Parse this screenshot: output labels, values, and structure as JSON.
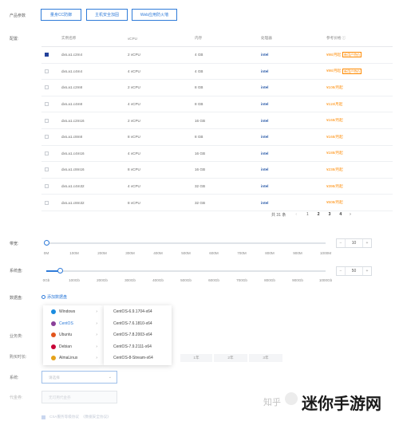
{
  "labels": {
    "product": "产品参数",
    "config": "配置:",
    "bandwidth": "带宽:",
    "system_disk": "系统盘:",
    "data_disk": "数据盘:",
    "business": "业务类:",
    "purchase_time": "购买时长:",
    "system": "系统:",
    "agent": "代金券:"
  },
  "top_buttons": [
    "量身CC防御",
    "主机安全加固",
    "Web应用防火墙"
  ],
  "table": {
    "headers": [
      "实例名称",
      "vCPU",
      "内存",
      "处理器",
      "参考价格"
    ],
    "info_icon": "ⓘ",
    "rows": [
      {
        "name": "dxs.a1.c2m4",
        "vcpu": "2 vCPU",
        "mem": "4 GB",
        "proc": "intel",
        "price": "¥98/月起",
        "tag": "新用户特价",
        "checked": true
      },
      {
        "name": "dxs.a1.c4m4",
        "vcpu": "4 vCPU",
        "mem": "4 GB",
        "proc": "intel",
        "price": "¥98/月起",
        "tag": "新用户特价",
        "checked": false
      },
      {
        "name": "dxs.a1.c2m8",
        "vcpu": "2 vCPU",
        "mem": "8 GB",
        "proc": "intel",
        "price": "¥108/月起",
        "tag": "",
        "checked": false
      },
      {
        "name": "dxs.a1.c4m8",
        "vcpu": "4 vCPU",
        "mem": "8 GB",
        "proc": "intel",
        "price": "¥118/月起",
        "tag": "",
        "checked": false
      },
      {
        "name": "dxs.a1.c2m16",
        "vcpu": "2 vCPU",
        "mem": "16 GB",
        "proc": "intel",
        "price": "¥168/月起",
        "tag": "",
        "checked": false
      },
      {
        "name": "dxs.a1.c8m8",
        "vcpu": "8 vCPU",
        "mem": "8 GB",
        "proc": "intel",
        "price": "¥168/月起",
        "tag": "",
        "checked": false
      },
      {
        "name": "dxs.a1.c4m16",
        "vcpu": "4 vCPU",
        "mem": "16 GB",
        "proc": "intel",
        "price": "¥188/月起",
        "tag": "",
        "checked": false
      },
      {
        "name": "dxs.a1.c8m16",
        "vcpu": "8 vCPU",
        "mem": "16 GB",
        "proc": "intel",
        "price": "¥238/月起",
        "tag": "",
        "checked": false
      },
      {
        "name": "dxs.a1.c4m32",
        "vcpu": "4 vCPU",
        "mem": "32 GB",
        "proc": "intel",
        "price": "¥398/月起",
        "tag": "",
        "checked": false
      },
      {
        "name": "dxs.a1.c8m32",
        "vcpu": "8 vCPU",
        "mem": "32 GB",
        "proc": "intel",
        "price": "¥508/月起",
        "tag": "",
        "checked": false
      }
    ]
  },
  "pagination": {
    "total": "共 31 条",
    "prev": "‹",
    "pages": [
      "1",
      "2",
      "3",
      "4"
    ],
    "next": "›"
  },
  "bandwidth": {
    "ticks": [
      "0M",
      "100M",
      "200M",
      "300M",
      "400M",
      "500M",
      "600M",
      "700M",
      "800M",
      "900M",
      "1000M"
    ],
    "value": "10",
    "minus": "−",
    "plus": "+",
    "level": 0
  },
  "system_disk": {
    "ticks": [
      "0Gb",
      "100Gb",
      "200Gb",
      "300Gb",
      "400Gb",
      "500Gb",
      "600Gb",
      "700Gb",
      "800Gb",
      "900Gb",
      "1000Gb"
    ],
    "value": "50",
    "minus": "−",
    "plus": "+",
    "level": 0.05
  },
  "data_disk": {
    "add_label": "添加数据盘"
  },
  "os_menu": [
    {
      "name": "Windows",
      "icon": "windows-icon",
      "color": "#1a8ce0",
      "active": false
    },
    {
      "name": "CentOS",
      "icon": "centos-icon",
      "color": "#8a3f99",
      "active": true
    },
    {
      "name": "Ubuntu",
      "icon": "ubuntu-icon",
      "color": "#e2541c",
      "active": false
    },
    {
      "name": "Debian",
      "icon": "debian-icon",
      "color": "#c70036",
      "active": false
    },
    {
      "name": "AlmaLinux",
      "icon": "almalinux-icon",
      "color": "#e5a21b",
      "active": false
    }
  ],
  "version_menu": [
    "CentOS-6.9.1704-x64",
    "CentOS-7.6.1810-x64",
    "CentOS-7.8.2003-x64",
    "CentOS-7.9.2111-x64",
    "CentOS-8-Stream-x64"
  ],
  "durations": [
    "1年",
    "2年",
    "3年"
  ],
  "system_placeholder": "请选择",
  "agent_placeholder": "无可用代金券",
  "agreements": [
    "CSA服务等级协议",
    "《数据安全协议》"
  ],
  "watermark": {
    "zhihu": "知乎",
    "site": "迷你手游网"
  },
  "colors": {
    "accent": "#2f7bd9",
    "price": "#ff8a00",
    "checked": "#23419a"
  }
}
